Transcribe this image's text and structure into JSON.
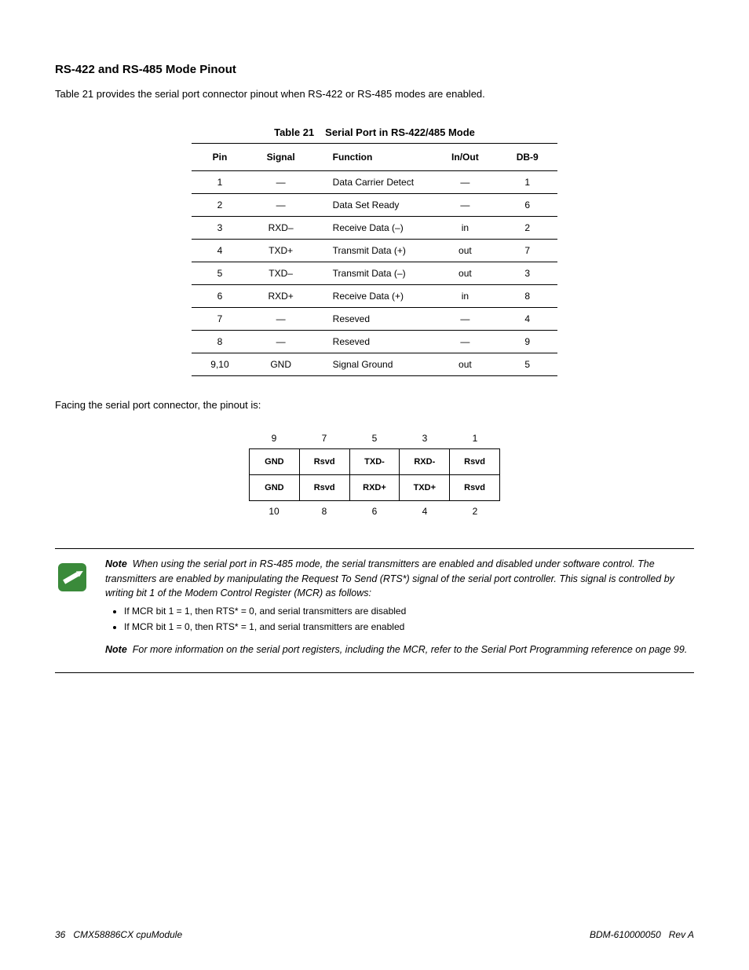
{
  "section_heading": "RS-422 and RS-485 Mode Pinout",
  "intro_paragraph": "Table 21 provides the serial port connector pinout when RS-422 or RS-485 modes are enabled.",
  "table_caption_number": "Table 21",
  "table_caption_title": "Serial Port in RS-422/485 Mode",
  "table_headers": {
    "pin": "Pin",
    "signal": "Signal",
    "function": "Function",
    "inout": "In/Out",
    "db9": "DB-9"
  },
  "table_rows": [
    {
      "pin": "1",
      "signal": "—",
      "function": "Data Carrier Detect",
      "inout": "—",
      "db9": "1"
    },
    {
      "pin": "2",
      "signal": "—",
      "function": "Data Set Ready",
      "inout": "—",
      "db9": "6"
    },
    {
      "pin": "3",
      "signal": "RXD–",
      "function": "Receive Data (–)",
      "inout": "in",
      "db9": "2"
    },
    {
      "pin": "4",
      "signal": "TXD+",
      "function": "Transmit Data (+)",
      "inout": "out",
      "db9": "7"
    },
    {
      "pin": "5",
      "signal": "TXD–",
      "function": "Transmit Data (–)",
      "inout": "out",
      "db9": "3"
    },
    {
      "pin": "6",
      "signal": "RXD+",
      "function": "Receive Data (+)",
      "inout": "in",
      "db9": "8"
    },
    {
      "pin": "7",
      "signal": "—",
      "function": "Reseved",
      "inout": "—",
      "db9": "4"
    },
    {
      "pin": "8",
      "signal": "—",
      "function": "Reseved",
      "inout": "—",
      "db9": "9"
    },
    {
      "pin": "9,10",
      "signal": "GND",
      "function": "Signal Ground",
      "inout": "out",
      "db9": "5"
    }
  ],
  "facing_text": "Facing the serial port connector, the pinout is:",
  "pinout_diagram": {
    "top_numbers": [
      "9",
      "7",
      "5",
      "3",
      "1"
    ],
    "row1": [
      "GND",
      "Rsvd",
      "TXD-",
      "RXD-",
      "Rsvd"
    ],
    "row2": [
      "GND",
      "Rsvd",
      "RXD+",
      "TXD+",
      "Rsvd"
    ],
    "bottom_numbers": [
      "10",
      "8",
      "6",
      "4",
      "2"
    ]
  },
  "note": {
    "label": "Note",
    "para1": "When using the serial port in RS-485 mode, the serial transmitters are enabled and disabled under software control. The transmitters are enabled by manipulating the Request To Send (RTS*) signal of the serial port controller. This signal is controlled by writing bit 1 of the Modem Control Register (MCR) as follows:",
    "bullet1": "If MCR bit 1 = 1, then RTS* = 0, and serial transmitters are disabled",
    "bullet2": "If MCR bit 1 = 0, then RTS* = 1, and serial transmitters are enabled",
    "para2": "For more information on the serial port registers, including the MCR, refer to the Serial Port Programming reference on page 99."
  },
  "footer": {
    "left_page": "36",
    "left_title": "CMX58886CX cpuModule",
    "right_doc": "BDM-610000050",
    "right_rev": "Rev A"
  }
}
